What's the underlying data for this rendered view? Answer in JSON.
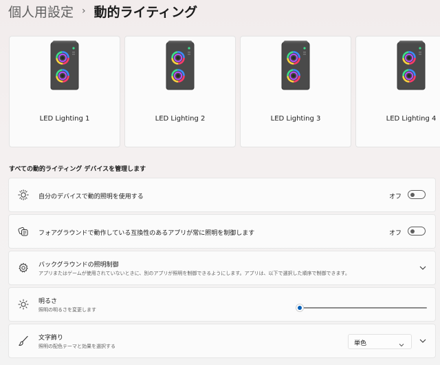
{
  "breadcrumb": {
    "parent": "個人用設定",
    "separator": "›",
    "current": "動的ライティング"
  },
  "devices": [
    {
      "label": "LED Lighting 1",
      "icon": "pc-tower-rgb-icon"
    },
    {
      "label": "LED Lighting 2",
      "icon": "pc-tower-rgb-icon"
    },
    {
      "label": "LED Lighting 3",
      "icon": "pc-tower-rgb-icon"
    },
    {
      "label": "LED Lighting 4",
      "icon": "pc-tower-rgb-icon"
    }
  ],
  "section_title": "すべての動的ライティング デバイスを管理します",
  "settings": {
    "use_lighting": {
      "title": "自分のデバイスで動的照明を使用する",
      "state": "オフ",
      "enabled": false,
      "icon": "lighting-sun-icon"
    },
    "foreground_control": {
      "title": "フォアグラウンドで動作している互換性のあるアプリが常に照明を制御します",
      "state": "オフ",
      "enabled": false,
      "icon": "layers-app-icon"
    },
    "background_control": {
      "title": "バックグラウンドの照明制御",
      "subtitle": "アプリまたはゲームが使用されていないときに、別のアプリが照明を制御できるようにします。アプリは、以下で選択した順序で制御できます。",
      "icon": "gear-icon"
    },
    "brightness": {
      "title": "明るさ",
      "subtitle": "照明の明るさを変更します",
      "value_percent": 0,
      "icon": "brightness-icon"
    },
    "effects": {
      "title": "文字飾り",
      "subtitle": "照明の配色テーマと効果を選択する",
      "selected": "単色",
      "icon": "brush-icon"
    }
  },
  "colors": {
    "accent": "#005fb8",
    "card_bg": "#fbfbfb",
    "tower_body": "#4a4a4a"
  }
}
